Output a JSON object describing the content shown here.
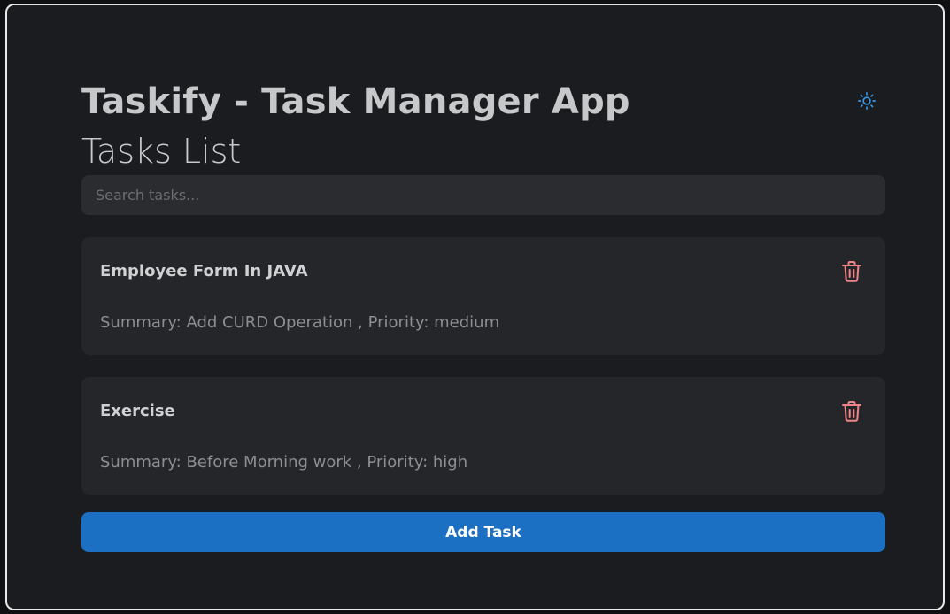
{
  "header": {
    "app_title": "Taskify - Task Manager App",
    "theme_toggle_icon": "sun-icon",
    "section_title": "Tasks List"
  },
  "search": {
    "placeholder": "Search tasks...",
    "value": ""
  },
  "tasks": [
    {
      "title": "Employee Form In JAVA",
      "summary_text": "Summary: Add CURD Operation , Priority: medium",
      "delete_icon": "trash-icon"
    },
    {
      "title": "Exercise",
      "summary_text": "Summary: Before Morning work , Priority: high",
      "delete_icon": "trash-icon"
    }
  ],
  "actions": {
    "add_task_label": "Add Task"
  },
  "colors": {
    "accent": "#1c70c4",
    "theme_icon": "#3a97e8",
    "delete_icon": "#f08488",
    "background": "#1b1c1f",
    "card": "#25262a"
  }
}
